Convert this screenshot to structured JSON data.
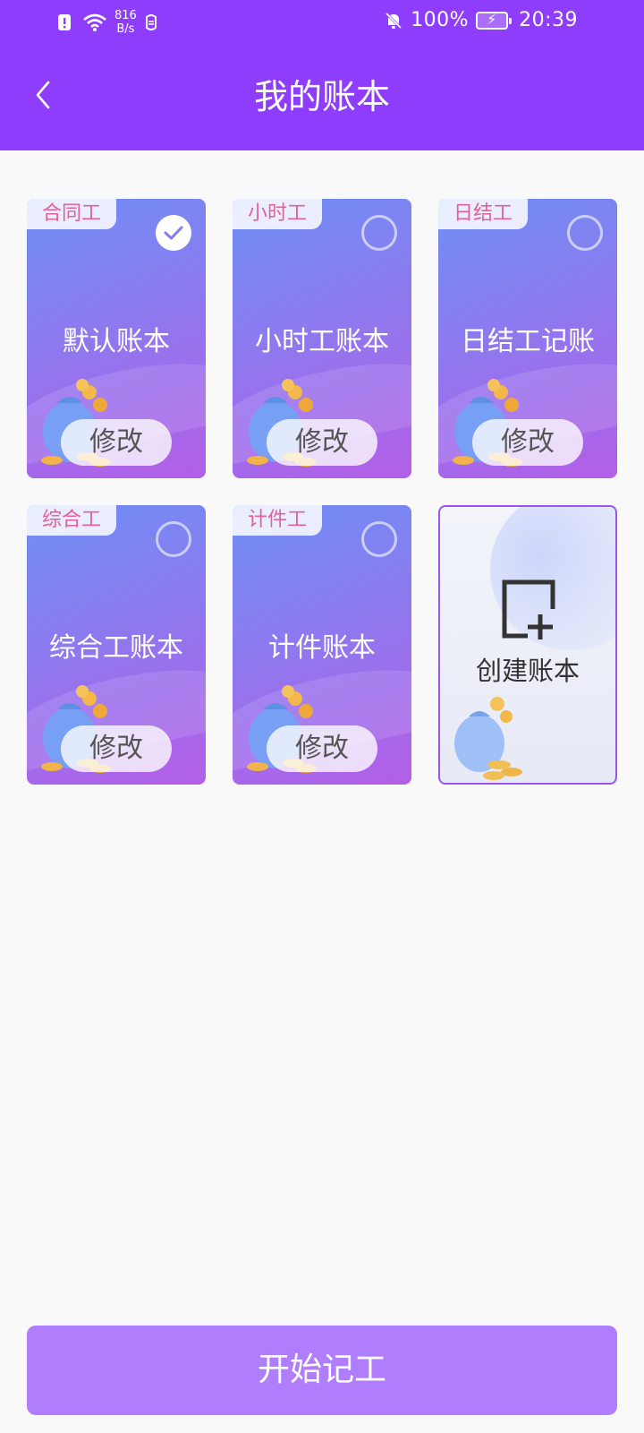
{
  "status_bar": {
    "net_speed_value": "816",
    "net_speed_unit": "B/s",
    "battery": "100%",
    "time": "20:39"
  },
  "header": {
    "title": "我的账本",
    "back_icon": "chevron-left-icon"
  },
  "books": [
    {
      "tag": "合同工",
      "name": "默认账本",
      "edit_label": "修改",
      "selected": true
    },
    {
      "tag": "小时工",
      "name": "小时工账本",
      "edit_label": "修改",
      "selected": false
    },
    {
      "tag": "日结工",
      "name": "日结工记账",
      "edit_label": "修改",
      "selected": false
    },
    {
      "tag": "综合工",
      "name": "综合工账本",
      "edit_label": "修改",
      "selected": false
    },
    {
      "tag": "计件工",
      "name": "计件账本",
      "edit_label": "修改",
      "selected": false
    }
  ],
  "create_card": {
    "label": "创建账本",
    "icon": "add-book-icon"
  },
  "footer": {
    "start_label": "开始记工"
  },
  "colors": {
    "header_bg": "#8f3dfd",
    "tag_text": "#e0619b",
    "start_button": "#b07efd",
    "create_border": "#9b55f2"
  }
}
